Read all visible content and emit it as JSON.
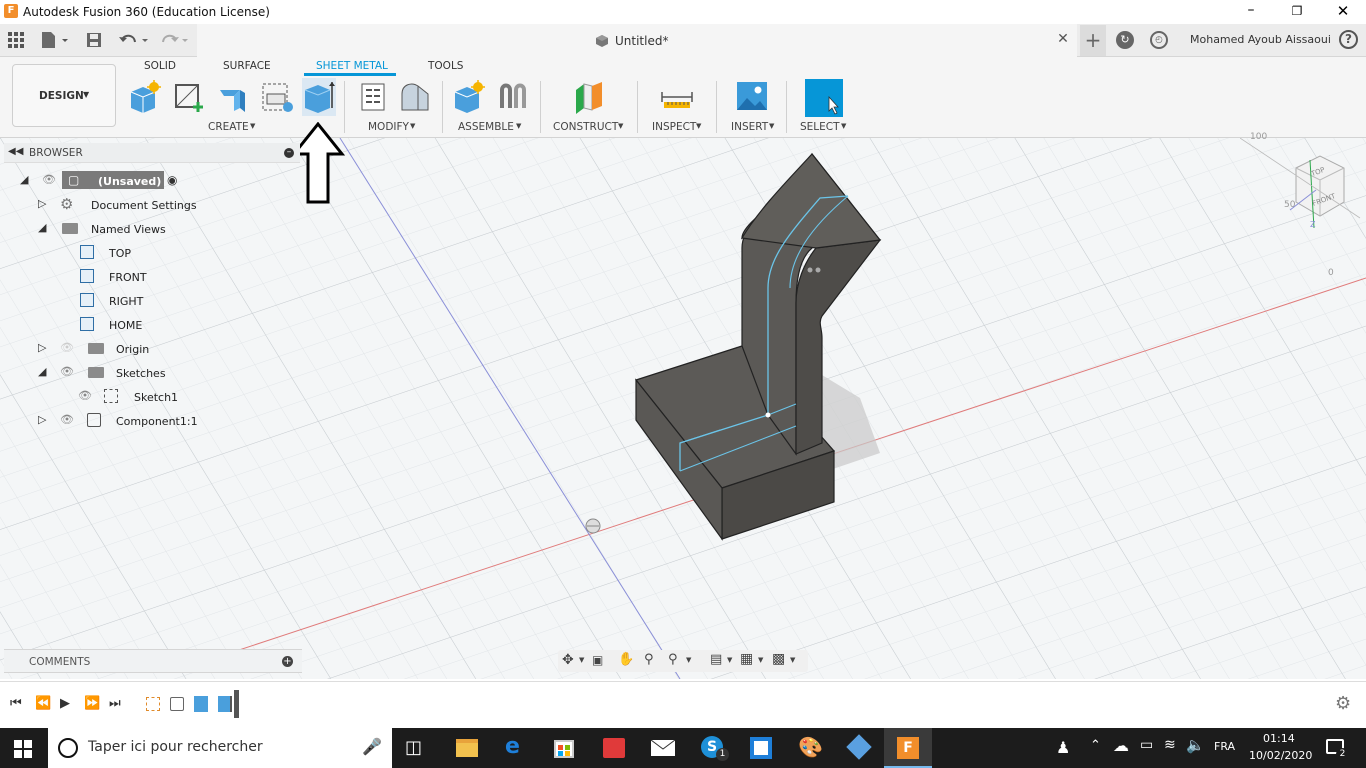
{
  "window": {
    "title": "Autodesk Fusion 360 (Education License)"
  },
  "document": {
    "tab_title": "Untitled*",
    "user": "Mohamed Ayoub Aissaoui"
  },
  "workspace": {
    "label": "DESIGN"
  },
  "ribbon": {
    "tabs": [
      "SOLID",
      "SURFACE",
      "SHEET METAL",
      "TOOLS"
    ],
    "active_tab": "SHEET METAL",
    "groups": {
      "create": "CREATE",
      "modify": "MODIFY",
      "assemble": "ASSEMBLE",
      "construct": "CONSTRUCT",
      "inspect": "INSPECT",
      "insert": "INSERT",
      "select": "SELECT"
    }
  },
  "browser": {
    "title": "BROWSER",
    "root": "(Unsaved)",
    "items": [
      "Document Settings",
      "Named Views",
      "TOP",
      "FRONT",
      "RIGHT",
      "HOME",
      "Origin",
      "Sketches",
      "Sketch1",
      "Component1:1"
    ]
  },
  "comments": {
    "title": "COMMENTS"
  },
  "viewcube": {
    "top": "TOP",
    "front": "FRONT",
    "axis_z": "Z",
    "num1": "50",
    "num2": "100",
    "num3": "0"
  },
  "taskbar": {
    "search_placeholder": "Taper ici pour rechercher",
    "lang": "FRA",
    "time": "01:14",
    "date": "10/02/2020",
    "notifications": "2",
    "skype_badge": "1"
  },
  "colors": {
    "accent": "#0696d7",
    "tab_active": "#0696d7",
    "taskbar_bg": "#1c1c1c",
    "model": "#555350"
  }
}
